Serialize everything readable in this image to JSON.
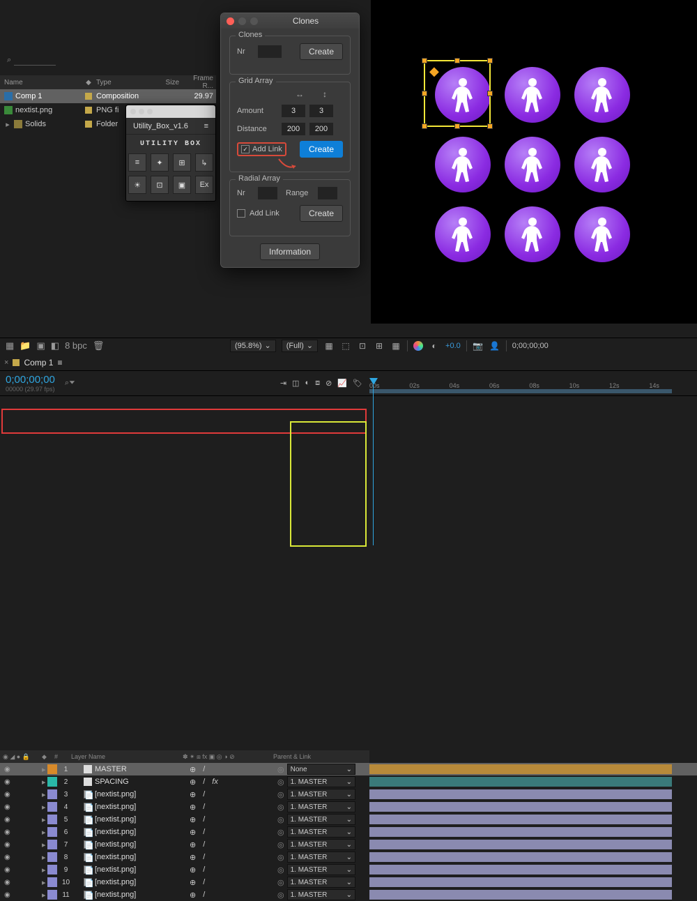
{
  "project": {
    "search_placeholder": "",
    "search_icon": "⌕",
    "headers": {
      "name": "Name",
      "type": "Type",
      "size": "Size",
      "frame": "Frame R..."
    },
    "rows": [
      {
        "name": "Comp 1",
        "type": "Composition",
        "size": "",
        "frame": "29.97",
        "icon": "comp"
      },
      {
        "name": "nextist.png",
        "type": "PNG fi",
        "size": "",
        "frame": "",
        "icon": "png"
      },
      {
        "name": "Solids",
        "type": "Folder",
        "size": "",
        "frame": "",
        "icon": "folder",
        "twirl": true
      }
    ]
  },
  "utility": {
    "title": "Utility_Box_v1.6",
    "logo": "UTILITY BOX",
    "buttons": [
      "≡",
      "✦",
      "⊞",
      "↳",
      "☀",
      "⊡",
      "▣",
      "Ex"
    ]
  },
  "modal": {
    "title": "Clones",
    "clones": {
      "legend": "Clones",
      "nr_label": "Nr",
      "nr": "",
      "create": "Create"
    },
    "grid": {
      "legend": "Grid Array",
      "amount_label": "Amount",
      "amount_x": "3",
      "amount_y": "3",
      "distance_label": "Distance",
      "dist_x": "200",
      "dist_y": "200",
      "addlink_label": "Add Link",
      "addlink_checked": true,
      "create": "Create"
    },
    "radial": {
      "legend": "Radial Array",
      "nr_label": "Nr",
      "nr": "",
      "range_label": "Range",
      "range": "",
      "addlink_label": "Add Link",
      "addlink_checked": false,
      "create": "Create"
    },
    "info": "Information"
  },
  "footer_proj": {
    "bpc": "8 bpc"
  },
  "footer_prev": {
    "zoom": "(95.8%)",
    "res": "(Full)",
    "cache": "+0.0",
    "timecode": "0;00;00;00"
  },
  "timeline": {
    "tab": "Comp 1",
    "timecode": "0;00;00;00",
    "timecode_sub": "00000 (29.97 fps)",
    "col_heads": {
      "num": "#",
      "layer": "Layer Name",
      "switches": "✽ ✴ ⧈ fx ▣ ◎ ◑ ⊘",
      "parent": "Parent & Link"
    },
    "ruler": [
      "00s",
      "02s",
      "04s",
      "06s",
      "08s",
      "10s",
      "12s",
      "14s"
    ],
    "parent_none": "None",
    "layers": [
      {
        "n": 1,
        "name": "MASTER",
        "tag": "#d88a2a",
        "icon": "solid",
        "parent": "None",
        "bar": "orange",
        "hi": true,
        "fx": ""
      },
      {
        "n": 2,
        "name": "SPACING",
        "tag": "#2ab8a8",
        "icon": "solid",
        "parent": "1. MASTER",
        "bar": "teal",
        "fx": "fx"
      },
      {
        "n": 3,
        "name": "[nextist.png]",
        "tag": "#8a8ad0",
        "icon": "img",
        "parent": "1. MASTER",
        "bar": "lav",
        "fx": ""
      },
      {
        "n": 4,
        "name": "[nextist.png]",
        "tag": "#8a8ad0",
        "icon": "img",
        "parent": "1. MASTER",
        "bar": "lav",
        "fx": ""
      },
      {
        "n": 5,
        "name": "[nextist.png]",
        "tag": "#8a8ad0",
        "icon": "img",
        "parent": "1. MASTER",
        "bar": "lav",
        "fx": ""
      },
      {
        "n": 6,
        "name": "[nextist.png]",
        "tag": "#8a8ad0",
        "icon": "img",
        "parent": "1. MASTER",
        "bar": "lav",
        "fx": ""
      },
      {
        "n": 7,
        "name": "[nextist.png]",
        "tag": "#8a8ad0",
        "icon": "img",
        "parent": "1. MASTER",
        "bar": "lav",
        "fx": ""
      },
      {
        "n": 8,
        "name": "[nextist.png]",
        "tag": "#8a8ad0",
        "icon": "img",
        "parent": "1. MASTER",
        "bar": "lav",
        "fx": ""
      },
      {
        "n": 9,
        "name": "[nextist.png]",
        "tag": "#8a8ad0",
        "icon": "img",
        "parent": "1. MASTER",
        "bar": "lav",
        "fx": ""
      },
      {
        "n": 10,
        "name": "[nextist.png]",
        "tag": "#8a8ad0",
        "icon": "img",
        "parent": "1. MASTER",
        "bar": "lav",
        "fx": ""
      },
      {
        "n": 11,
        "name": "[nextist.png]",
        "tag": "#8a8ad0",
        "icon": "img",
        "parent": "1. MASTER",
        "bar": "lav",
        "fx": ""
      }
    ]
  }
}
